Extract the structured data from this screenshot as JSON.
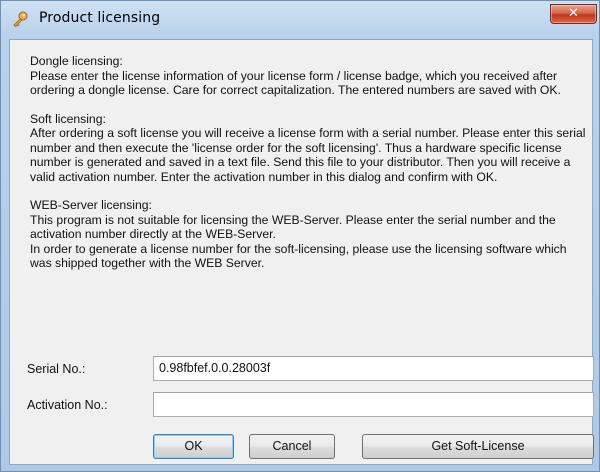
{
  "window": {
    "title": "Product licensing",
    "close_symbol": "✕"
  },
  "sections": [
    {
      "heading": "Dongle licensing:",
      "paragraphs": [
        "Please enter the license information of your license form / license badge, which you received after ordering a dongle license. Care for correct capitalization. The entered numbers are saved with OK."
      ]
    },
    {
      "heading": "Soft licensing:",
      "paragraphs": [
        "After ordering a soft license you will receive a license form with a serial number. Please enter this serial number and then execute the 'license order for the soft licensing'. Thus a hardware specific license number is generated and saved in a text file. Send this file to your distributor. Then you will receive a valid activation number. Enter the activation number in this dialog and confirm with OK."
      ]
    },
    {
      "heading": "WEB-Server licensing:",
      "paragraphs": [
        "This program is not suitable for licensing the WEB-Server. Please enter the serial number and the activation number directly at the WEB-Server.",
        "In order to generate a license number for the soft-licensing, please use the licensing software which was shipped together with the WEB Server."
      ]
    }
  ],
  "form": {
    "serial_label": "Serial No.:",
    "serial_value": "0.98fbfef.0.0.28003f",
    "activation_label": "Activation No.:",
    "activation_value": ""
  },
  "buttons": {
    "ok": "OK",
    "cancel": "Cancel",
    "soft_license": "Get Soft-License"
  },
  "icons": {
    "title": "key-icon",
    "close": "close-icon"
  }
}
